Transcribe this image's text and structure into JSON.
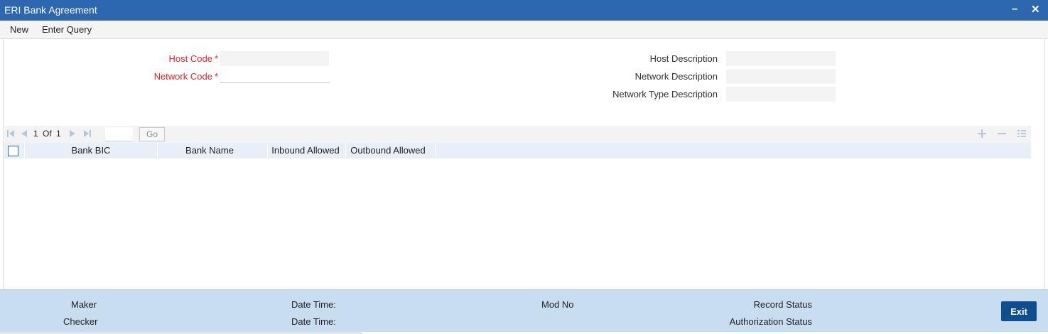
{
  "window": {
    "title": "ERI Bank Agreement",
    "minimize": "–",
    "close": "✕"
  },
  "toolbar": {
    "new_label": "New",
    "enter_query_label": "Enter Query"
  },
  "form": {
    "host_code_label": "Host Code",
    "network_code_label": "Network Code",
    "required_marker": "*",
    "host_code_value": "",
    "network_code_value": "",
    "host_description_label": "Host Description",
    "network_description_label": "Network Description",
    "network_type_description_label": "Network Type Description",
    "host_description_value": "",
    "network_description_value": "",
    "network_type_description_value": ""
  },
  "grid": {
    "page_current": "1",
    "page_of": "Of",
    "page_total": "1",
    "page_input_value": "",
    "go_label": "Go",
    "columns": [
      "Bank BIC",
      "Bank Name",
      "Inbound Allowed",
      "Outbound Allowed"
    ],
    "rows": []
  },
  "footer": {
    "maker_label": "Maker",
    "checker_label": "Checker",
    "date_time_label": "Date Time:",
    "mod_no_label": "Mod No",
    "record_status_label": "Record Status",
    "authorization_status_label": "Authorization Status",
    "exit_label": "Exit"
  },
  "colors": {
    "titlebar": "#2c67b0",
    "required": "#e8212b",
    "footer": "#c8ddf0",
    "exit_button": "#0e4e8e"
  },
  "icons": [
    "first-page-icon",
    "prev-page-icon",
    "next-page-icon",
    "last-page-icon",
    "add-row-icon",
    "delete-row-icon",
    "single-view-icon"
  ]
}
